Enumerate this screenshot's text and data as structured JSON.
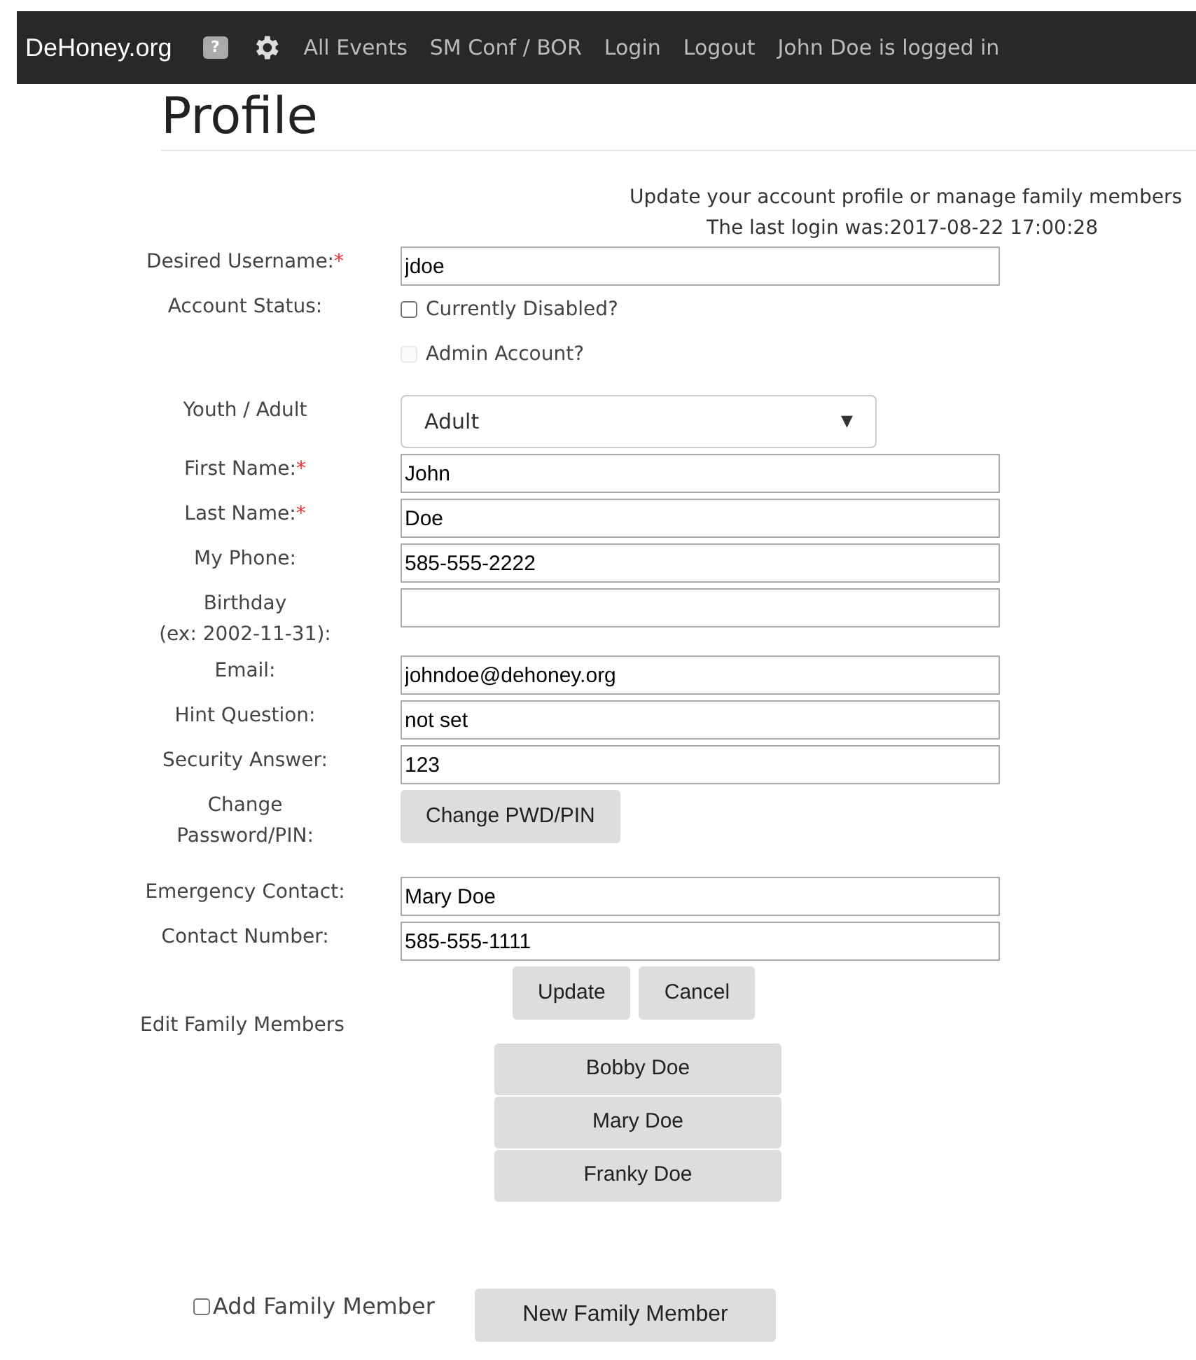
{
  "navbar": {
    "brand": "DeHoney.org",
    "help_glyph": "?",
    "links": [
      "All Events",
      "SM Conf / BOR",
      "Login",
      "Logout"
    ],
    "status": "John Doe is logged in"
  },
  "title": "Profile",
  "intro": "Update your account profile or manage family members",
  "last_login": "The last login was:2017-08-22 17:00:28",
  "fields": [
    {
      "kind": "text",
      "label": "Desired Username:",
      "required_mark": "*",
      "value": "jdoe"
    },
    {
      "kind": "checkboxes",
      "label": "Account Status:",
      "options": [
        {
          "label": "Currently Disabled?",
          "checked": false,
          "disabled": false
        },
        {
          "label": "Admin Account?",
          "checked": false,
          "disabled": true
        }
      ]
    },
    {
      "kind": "select",
      "label": "Youth / Adult",
      "value": "Adult",
      "arrow": "▼"
    },
    {
      "kind": "text",
      "label": "First Name:",
      "required_mark": "*",
      "value": "John"
    },
    {
      "kind": "text",
      "label": "Last Name:",
      "required_mark": "*",
      "value": "Doe"
    },
    {
      "kind": "text",
      "label": "My Phone:",
      "value": "585-555-2222"
    },
    {
      "kind": "text",
      "label": "Birthday",
      "hint": "(ex: 2002-11-31):"
    },
    {
      "kind": "text",
      "label": "Email:",
      "value": "johndoe@dehoney.org"
    },
    {
      "kind": "text",
      "label": "Hint Question:",
      "value": "not set"
    },
    {
      "kind": "text",
      "label": "Security Answer:",
      "value": "123"
    },
    {
      "kind": "button",
      "label": "Change",
      "hint": "Password/PIN:",
      "button": "Change PWD/PIN"
    },
    {
      "kind": "text",
      "label": "Emergency Contact:",
      "value": "Mary Doe"
    },
    {
      "kind": "text",
      "label": "Contact Number:",
      "value": "585-555-1111"
    }
  ],
  "actions": [
    "Update",
    "Cancel"
  ],
  "family": {
    "heading": "Edit Family Members",
    "members": [
      "Bobby Doe",
      "Mary Doe",
      "Franky Doe"
    ]
  },
  "add_member": {
    "label": "Add Family Member",
    "checked": false,
    "button": "New Family Member"
  }
}
